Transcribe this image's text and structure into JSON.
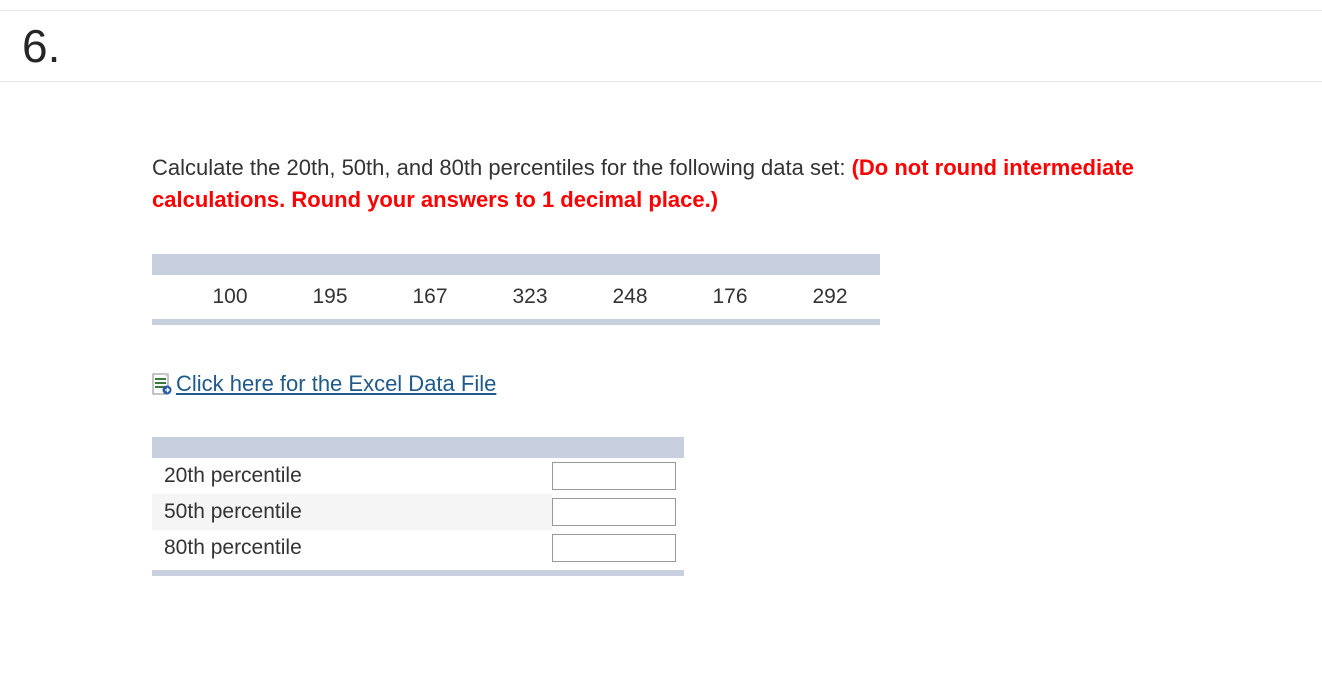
{
  "question_number": "6.",
  "prompt": {
    "text_before": "Calculate the 20th, 50th, and 80th percentiles for the following data set: ",
    "text_red": "(Do not round intermediate calculations. Round your answers to 1 decimal place.)"
  },
  "data_values": [
    "100",
    "195",
    "167",
    "323",
    "248",
    "176",
    "292"
  ],
  "excel_link": {
    "label": "Click here for the Excel Data File"
  },
  "answers": [
    {
      "label": "20th percentile",
      "value": ""
    },
    {
      "label": "50th percentile",
      "value": ""
    },
    {
      "label": "80th percentile",
      "value": ""
    }
  ]
}
